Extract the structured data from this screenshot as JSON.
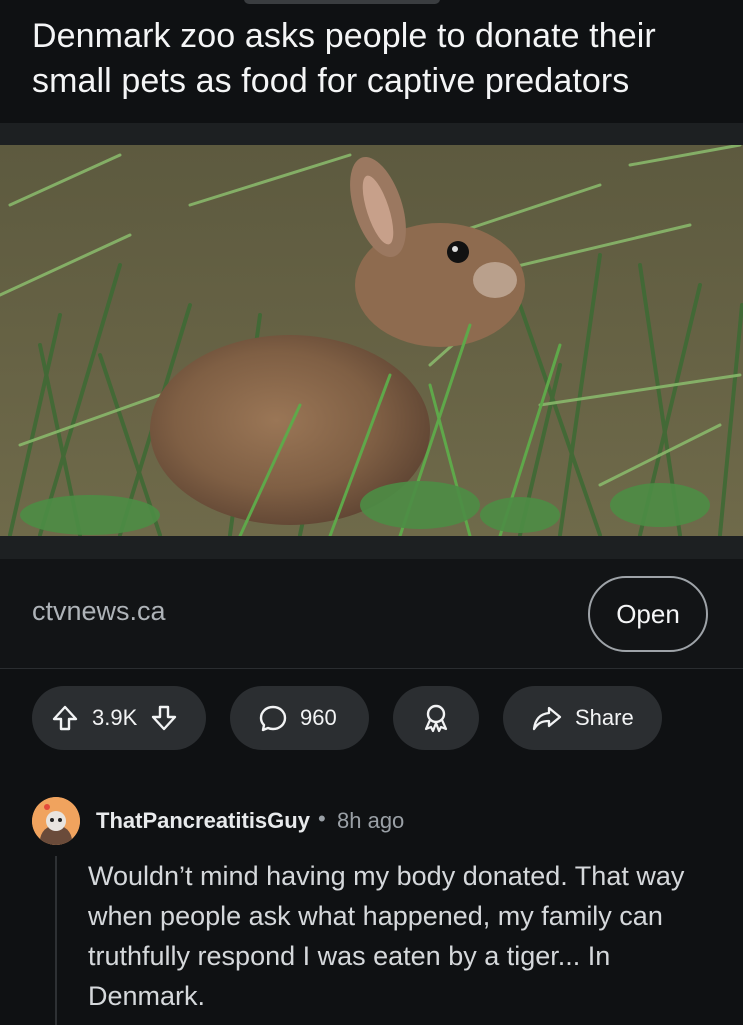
{
  "post": {
    "title": "Denmark zoo asks people to donate their small pets as food for captive predators"
  },
  "media": {
    "description_icon": "rabbit-photo"
  },
  "link": {
    "domain": "ctvnews.ca",
    "open_label": "Open"
  },
  "actions": {
    "vote_count": "3.9K",
    "comment_count": "960",
    "share_label": "Share"
  },
  "comment": {
    "author": "ThatPancreatitisGuy",
    "separator": "•",
    "time": "8h ago",
    "body": "Wouldn’t mind having my body donated. That way when people ask what happened, my family can truthfully respond I was eaten by a tiger... In Denmark."
  },
  "colors": {
    "background": "#0f1113",
    "pill": "#2b2e31",
    "avatar": "#f0a35e"
  }
}
